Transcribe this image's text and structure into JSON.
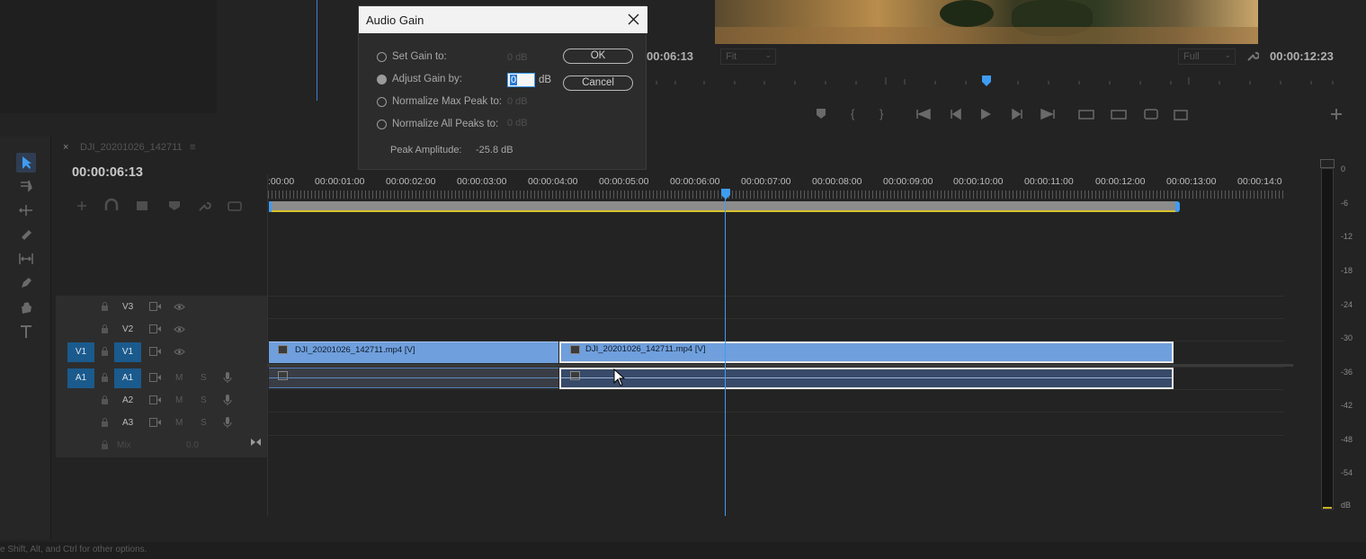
{
  "dialog": {
    "title": "Audio Gain",
    "options": [
      {
        "label": "Set Gain to:",
        "value": "0 dB",
        "selected": false
      },
      {
        "label": "Adjust Gain by:",
        "value": "0",
        "unit": "dB",
        "selected": true
      },
      {
        "label": "Normalize Max Peak to:",
        "value": "0 dB",
        "selected": false
      },
      {
        "label": "Normalize All Peaks to:",
        "value": "0 dB",
        "selected": false
      }
    ],
    "ok_label": "OK",
    "cancel_label": "Cancel",
    "peak_label": "Peak Amplitude:",
    "peak_value": "-25.8 dB"
  },
  "program_monitor": {
    "timecode_left": "00:06:13",
    "fit_label": "Fit",
    "quality_label": "Full",
    "duration": "00:00:12:23"
  },
  "timeline": {
    "sequence_name": "DJI_20201026_142711",
    "current_time": "00:00:06:13",
    "ruler_labels": [
      ":00:00",
      "00:00:01:00",
      "00:00:02:00",
      "00:00:03:00",
      "00:00:04:00",
      "00:00:05:00",
      "00:00:06:00",
      "00:00:07:00",
      "00:00:08:00",
      "00:00:09:00",
      "00:00:10:00",
      "00:00:11:00",
      "00:00:12:00",
      "00:00:13:00",
      "00:00:14:0"
    ],
    "video_tracks": [
      "V3",
      "V2",
      "V1"
    ],
    "audio_tracks": [
      "A1",
      "A2",
      "A3"
    ],
    "source_video_target": "V1",
    "source_audio_target": "A1",
    "mute_label": "M",
    "solo_label": "S",
    "mix_label": "Mix",
    "mix_value": "0.0",
    "clips": {
      "video_1": "DJI_20201026_142711.mp4 [V]",
      "video_2": "DJI_20201026_142711.mp4 [V]"
    }
  },
  "meter": {
    "labels": [
      "0",
      "-6",
      "-12",
      "-18",
      "-24",
      "-30",
      "-36",
      "-42",
      "-48",
      "-54",
      "dB"
    ]
  },
  "status_bar": {
    "text": "e Shift, Alt, and Ctrl for other options."
  },
  "colors": {
    "clip_video": "#6f9fdc",
    "clip_audio": "#384a69",
    "playhead": "#3f9cf2",
    "track_target": "#1b5a8c",
    "workarea": "#d8c22a"
  }
}
